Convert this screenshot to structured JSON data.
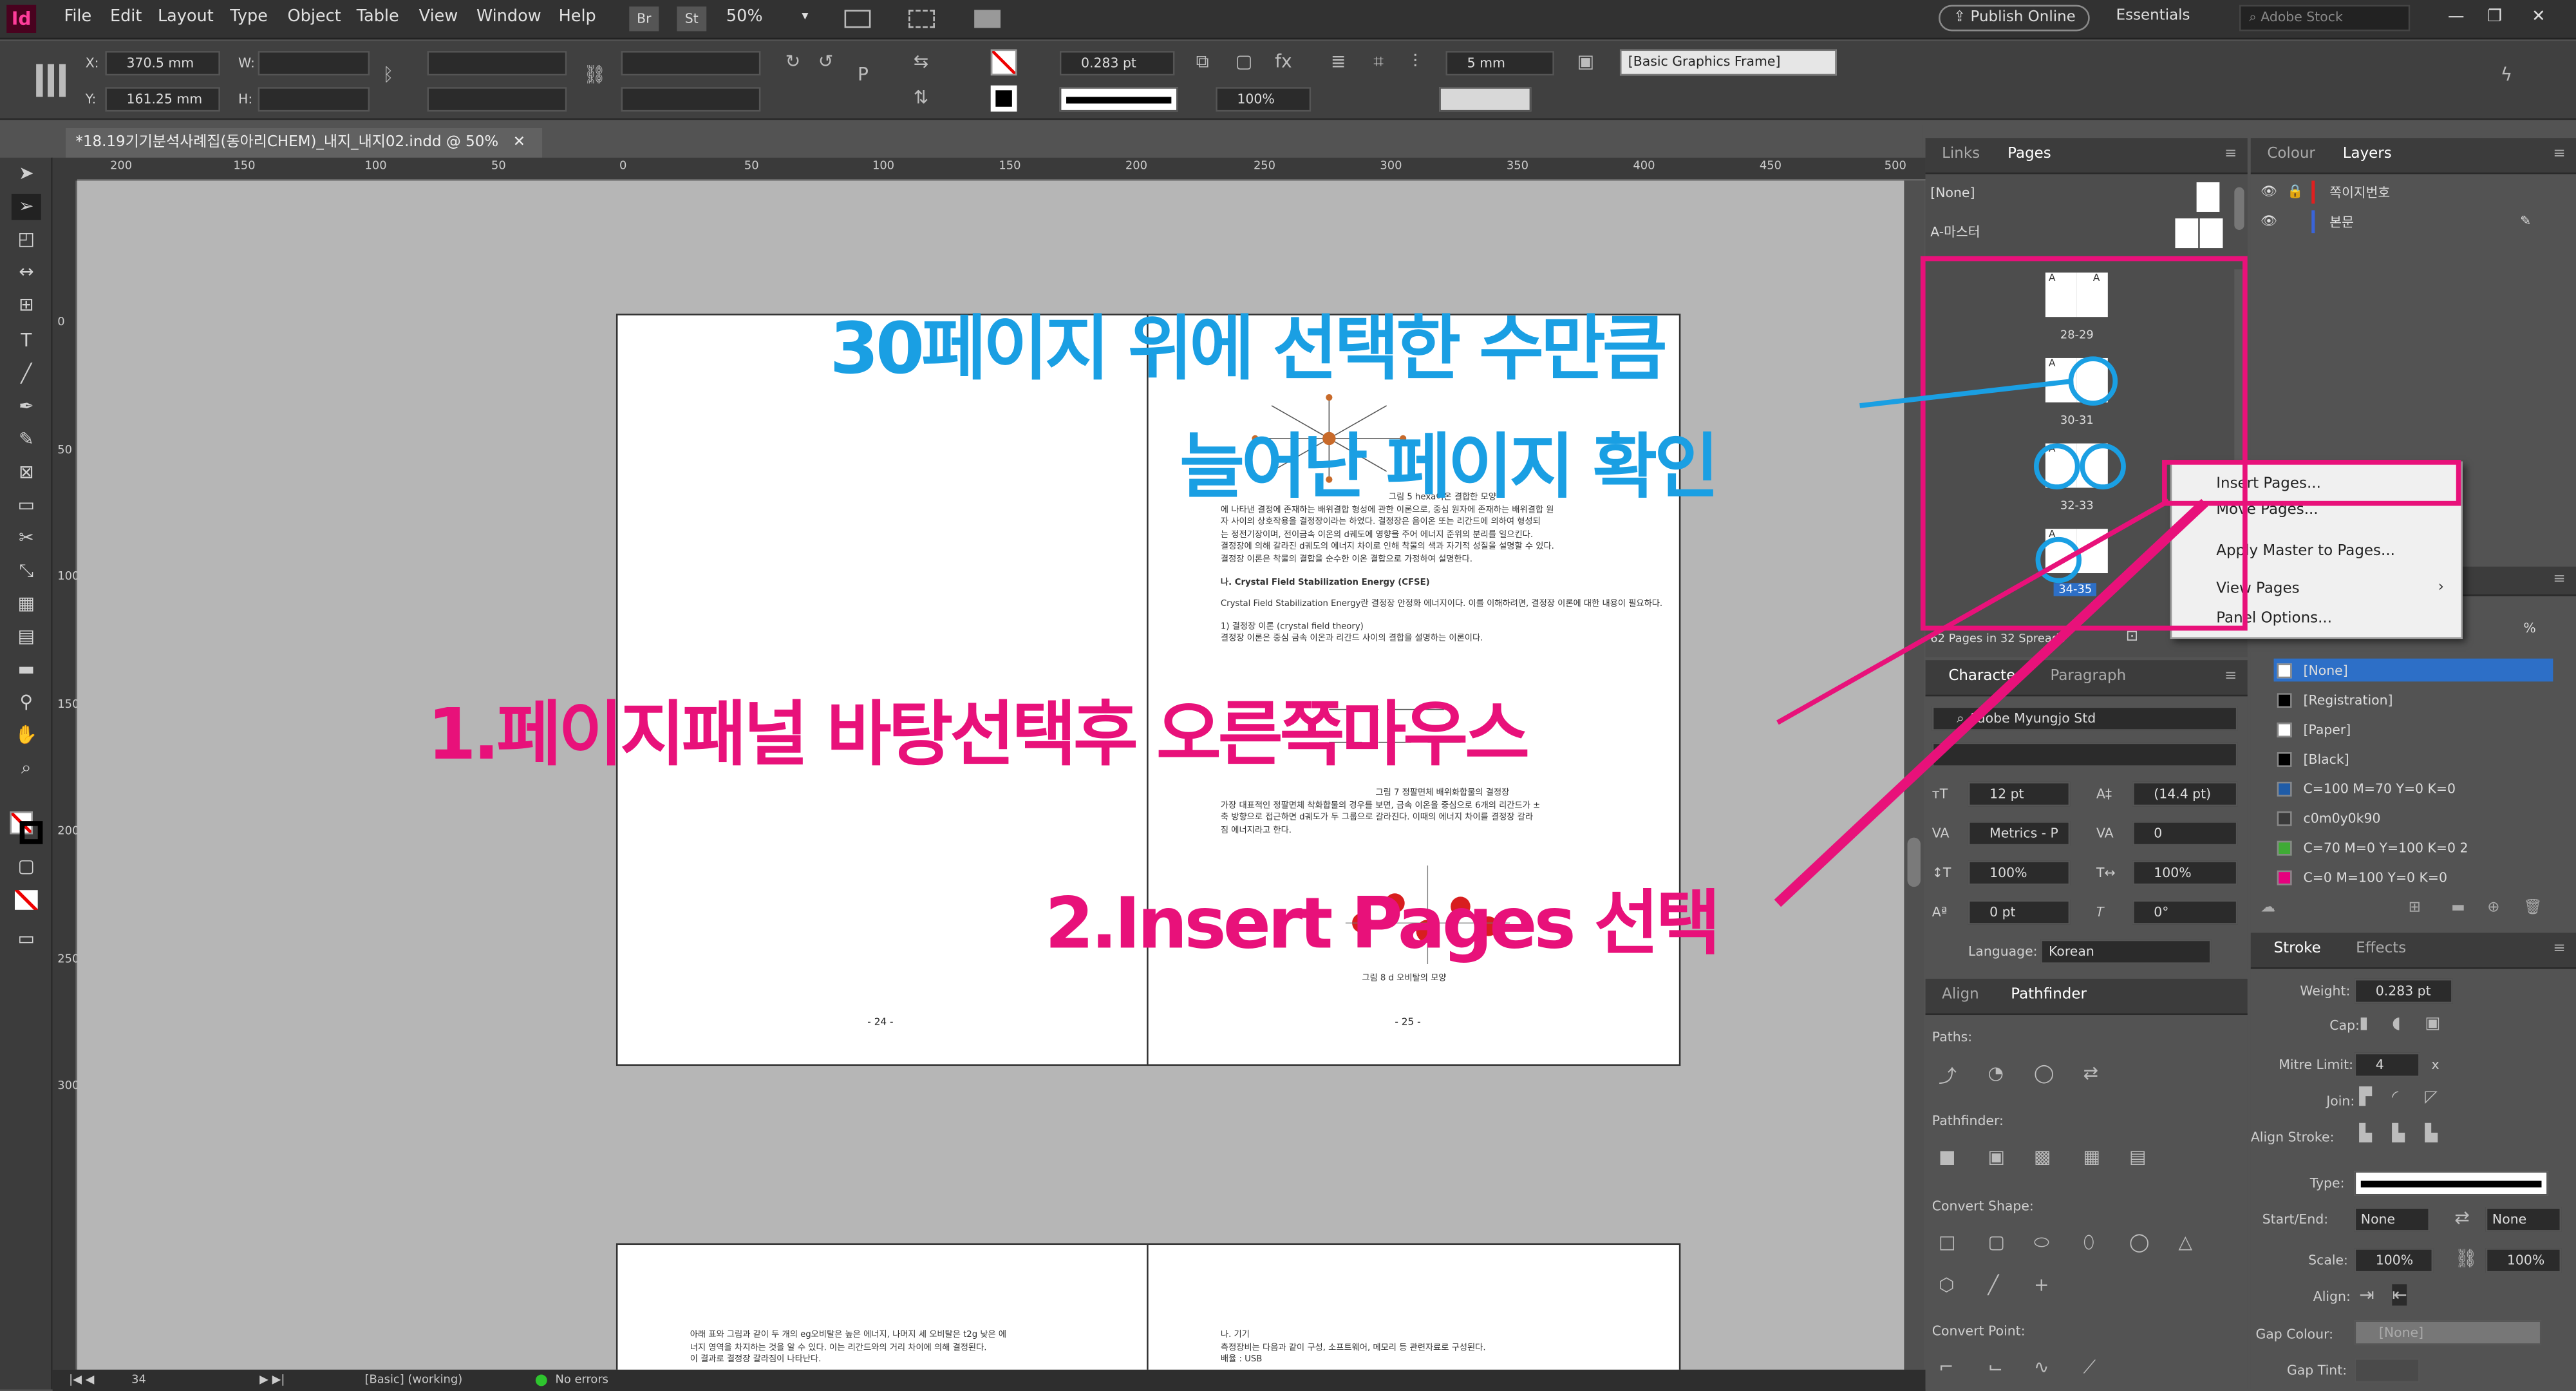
{
  "app": {
    "logo": "Id",
    "colors": {
      "accent_pink": "#e8117a",
      "accent_blue": "#1a9fe3",
      "menubar": "#323232"
    }
  },
  "menu": [
    "File",
    "Edit",
    "Layout",
    "Type",
    "Object",
    "Table",
    "View",
    "Window",
    "Help"
  ],
  "appbar": {
    "br": "Br",
    "st": "St",
    "zoom": "50%",
    "publish": "Publish Online",
    "workspace": "Essentials",
    "search_placeholder": "Adobe Stock"
  },
  "control": {
    "x_label": "X:",
    "x_value": "370.5 mm",
    "y_label": "Y:",
    "y_value": "161.25 mm",
    "w_label": "W:",
    "h_label": "H:",
    "stroke_weight": "0.283 pt",
    "scale_value": "100%",
    "gap_value": "5 mm",
    "object_style": "[Basic Graphics Frame]"
  },
  "document": {
    "tab_title": "*18.19기기분석사례집(동아리CHEM)_내지_내지02.indd @ 50%",
    "hruler_ticks": [
      "200",
      "150",
      "100",
      "50",
      "0",
      "50",
      "100",
      "150",
      "200",
      "250",
      "300",
      "350",
      "400",
      "450",
      "500"
    ],
    "vruler_ticks": [
      "0",
      "50",
      "100",
      "150",
      "200",
      "250",
      "300"
    ],
    "page_left_num": "- 24 -",
    "page_right_num": "- 25 -",
    "figure_caption_top": "그림 5 hexa이온 결합한 모양",
    "text_lines_top": [
      "에 나타낸 결정에 존재하는 배위결합 형성에 관한 이론으로, 중심 원자에 존재하는 배위결합 원",
      "자 사이의 상호작용을 결정장이라는 하였다. 결정장은 음이온 또는 리간드에 의하여 형성되",
      "는 정전기장이며, 전이금속 이온의 d궤도에 영향을 주어 에너지 준위의 분리를 일으킨다.",
      "결정장에 의해 갈라진 d궤도의 에너지 차이로 인해 착물의 색과 자기적 성질을 설명할 수 있다.",
      "결정장 이론은 착물의 결합을 순수한 이온 결합으로 가정하여 설명한다."
    ],
    "heading_cfse": "나. Crystal Field Stabilization Energy (CFSE)",
    "cfse_text": "Crystal Field Stabilization Energy란 결정장 안정화 에너지이다. 이를 이해하려면, 결정장 이론에 대한 내용이 필요하다.",
    "heading_cft": "1) 결정장 이론 (crystal field theory)",
    "cft_line": "결정장 이론은 중심 금속 이온과 리간드 사이의 결합을 설명하는 이론이다.",
    "figure_caption_mid": "그림 7 정팔면체 배위화합물의 결정장",
    "text_lines_mid": [
      "가장 대표적인 정팔면체 착화합물의 경우를 보면, 금속 이온을 중심으로 6개의 리간드가 ±",
      "축 방향으로 접근하면 d궤도가 두 그룹으로 갈라진다. 이때의 에너지 차이를 결정장 갈라",
      "짐 에너지라고 한다."
    ],
    "figure_caption_bottom": "그림 8 d 오비탈의 모양",
    "bottom_left_lines": [
      "아래 표와 그림과 같이 두 개의 eg오비탈은 높은 에너지, 나머지 세 오비탈은 t2g 낮은 에",
      "너지 영역을 차지하는 것을 알 수 있다. 이는 리간드와의 거리 차이에 의해 결정된다.",
      "이 결과로 결정장 갈라짐이 나타난다."
    ],
    "bottom_right_lines": [
      "나. 기기",
      "측정장비는 다음과 같이 구성, 소프트웨어, 메모리 등 관련자료로 구성된다.",
      "배율 : USB"
    ]
  },
  "status": {
    "page": "34",
    "master": "[Basic] (working)",
    "errors": "No errors"
  },
  "pages_panel": {
    "tabs": [
      "Links",
      "Pages"
    ],
    "none": "[None]",
    "master": "A-마스터",
    "spreads": [
      {
        "label": "28-29",
        "a": "A"
      },
      {
        "label": "30-31",
        "a": "A"
      },
      {
        "label": "32-33",
        "a": "A"
      },
      {
        "label": "34-35",
        "a": "A"
      }
    ],
    "footer": "62 Pages in 32 Spreads"
  },
  "context_menu": {
    "items": [
      "Insert Pages...",
      "Move Pages...",
      "Apply Master to Pages...",
      "View Pages",
      "Panel Options..."
    ]
  },
  "layers_panel": {
    "tabs": [
      "Colour",
      "Layers"
    ],
    "layers": [
      "쪽이지번호",
      "본문"
    ]
  },
  "swatches_panel": {
    "tint_label": "%",
    "items": [
      {
        "name": "[None]",
        "color": "#ffffff"
      },
      {
        "name": "[Registration]",
        "color": "#000000"
      },
      {
        "name": "[Paper]",
        "color": "#ffffff"
      },
      {
        "name": "[Black]",
        "color": "#000000"
      },
      {
        "name": "C=100 M=70 Y=0 K=0",
        "color": "#1f5ca8"
      },
      {
        "name": "c0m0y0k90",
        "color": "#3a3a3a"
      },
      {
        "name": "C=70 M=0 Y=100 K=0 2",
        "color": "#3fab35"
      },
      {
        "name": "C=0 M=100 Y=0 K=0",
        "color": "#e6007e"
      }
    ]
  },
  "character_panel": {
    "tabs": [
      "Character",
      "Paragraph"
    ],
    "font": "Adobe Myungjo Std",
    "size": "12 pt",
    "leading": "(14.4 pt)",
    "kerning": "Metrics - P",
    "tracking": "0",
    "vscale": "100%",
    "hscale": "100%",
    "baseline": "0 pt",
    "skew": "0°",
    "language_label": "Language:",
    "language": "Korean"
  },
  "pathfinder_panel": {
    "tabs": [
      "Align",
      "Pathfinder"
    ],
    "paths_label": "Paths:",
    "pathfinder_label": "Pathfinder:",
    "convert_shape_label": "Convert Shape:",
    "convert_point_label": "Convert Point:"
  },
  "stroke_panel": {
    "tabs": [
      "Stroke",
      "Effects"
    ],
    "weight_label": "Weight:",
    "weight": "0.283 pt",
    "cap_label": "Cap:",
    "mitre_label": "Mitre Limit:",
    "mitre": "4",
    "mitre_unit": "x",
    "join_label": "Join:",
    "align_label": "Align Stroke:",
    "type_label": "Type:",
    "start_end_label": "Start/End:",
    "start": "None",
    "end": "None",
    "scale_label": "Scale:",
    "scale_start": "100%",
    "scale_end": "100%",
    "align2_label": "Align:",
    "gap_colour_label": "Gap Colour:",
    "gap_colour": "[None]",
    "gap_tint_label": "Gap Tint:"
  },
  "annotations": {
    "blue_line1": "30페이지 위에 선택한 수만큼",
    "blue_line2": "늘어난 페이지 확인",
    "pink_step1": "1.페이지패널 바탕선택후 오른쪽마우스",
    "pink_step2": "2.Insert Pages 선택"
  }
}
